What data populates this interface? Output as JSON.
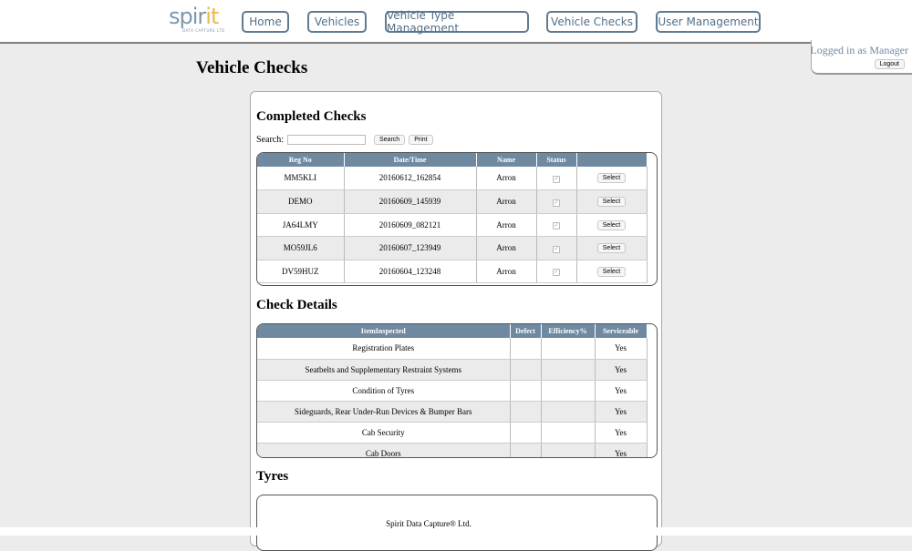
{
  "nav": {
    "logo_text_main": "spir",
    "logo_text_accent": "it",
    "logo_tagline": "DATA CAPTURE LTD",
    "items": [
      "Home",
      "Vehicles",
      "Vehicle Type Management",
      "Vehicle Checks",
      "User Management"
    ]
  },
  "login": {
    "status": "Logged in as Manager",
    "logout_label": "Logout"
  },
  "page": {
    "title": "Vehicle Checks"
  },
  "completed": {
    "title": "Completed Checks",
    "search_label": "Search:",
    "search_value": "",
    "search_button": "Search",
    "print_button": "Print",
    "columns": [
      "Reg No",
      "Date/Time",
      "Name",
      "Status",
      ""
    ],
    "select_label": "Select",
    "rows": [
      {
        "reg": "MM5KLI",
        "datetime": "20160612_162854",
        "name": "Arron",
        "status_checked": true
      },
      {
        "reg": "DEMO",
        "datetime": "20160609_145939",
        "name": "Arron",
        "status_checked": true
      },
      {
        "reg": "JA64LMY",
        "datetime": "20160609_082121",
        "name": "Arron",
        "status_checked": true
      },
      {
        "reg": "MO59JL6",
        "datetime": "20160607_123949",
        "name": "Arron",
        "status_checked": true
      },
      {
        "reg": "DV59HUZ",
        "datetime": "20160604_123248",
        "name": "Arron",
        "status_checked": true
      }
    ]
  },
  "details": {
    "title": "Check Details",
    "columns": [
      "ItemInspected",
      "Defect",
      "Efficiency%",
      "Serviceable"
    ],
    "rows": [
      {
        "item": "Registration Plates",
        "defect": "",
        "efficiency": "",
        "serviceable": "Yes"
      },
      {
        "item": "Seatbelts and Supplementary Restraint Systems",
        "defect": "",
        "efficiency": "",
        "serviceable": "Yes"
      },
      {
        "item": "Condition of Tyres",
        "defect": "",
        "efficiency": "",
        "serviceable": "Yes"
      },
      {
        "item": "Sideguards, Rear Under-Run Devices & Bumper Bars",
        "defect": "",
        "efficiency": "",
        "serviceable": "Yes"
      },
      {
        "item": "Cab Security",
        "defect": "",
        "efficiency": "",
        "serviceable": "Yes"
      },
      {
        "item": "Cab Doors",
        "defect": "",
        "efficiency": "",
        "serviceable": "Yes"
      }
    ]
  },
  "tyres": {
    "title": "Tyres"
  },
  "footer": {
    "text": "Spirit Data Capture® Ltd."
  }
}
